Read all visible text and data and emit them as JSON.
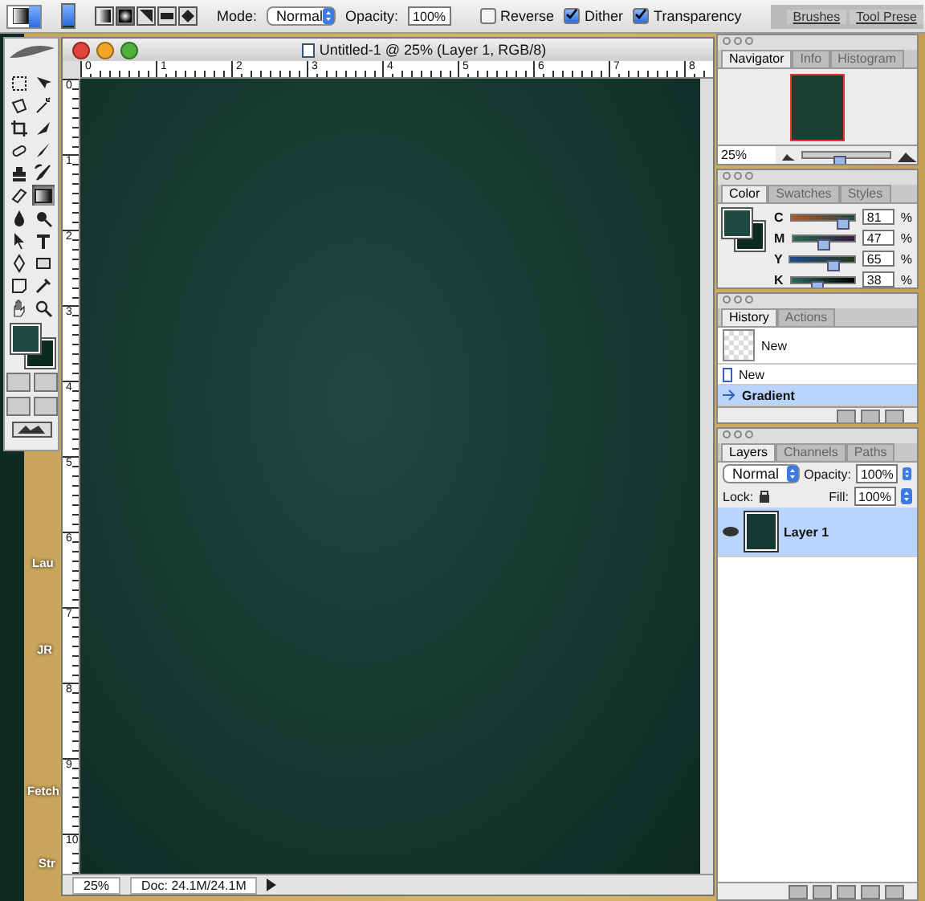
{
  "options_bar": {
    "gradient_types": [
      {
        "kind": "linear",
        "selected": false
      },
      {
        "kind": "radial",
        "selected": true
      },
      {
        "kind": "angle",
        "selected": false
      },
      {
        "kind": "reflected",
        "selected": false
      },
      {
        "kind": "diamond",
        "selected": false
      }
    ],
    "mode_label": "Mode:",
    "mode": "Normal",
    "opacity_label": "Opacity:",
    "opacity": "100%",
    "checkboxes": [
      {
        "label": "Reverse",
        "checked": false
      },
      {
        "label": "Dither",
        "checked": true
      },
      {
        "label": "Transparency",
        "checked": true
      }
    ],
    "well_tabs": [
      "Brushes",
      "Tool Prese"
    ]
  },
  "toolbox": {
    "tools": [
      {
        "kind": "marquee",
        "selected": false
      },
      {
        "kind": "move",
        "selected": false
      },
      {
        "kind": "lasso",
        "selected": false
      },
      {
        "kind": "wand",
        "selected": false
      },
      {
        "kind": "crop",
        "selected": false
      },
      {
        "kind": "slice",
        "selected": false
      },
      {
        "kind": "heal",
        "selected": false
      },
      {
        "kind": "brush",
        "selected": false
      },
      {
        "kind": "stamp",
        "selected": false
      },
      {
        "kind": "history",
        "selected": false
      },
      {
        "kind": "eraser",
        "selected": false
      },
      {
        "kind": "gradient",
        "selected": true
      },
      {
        "kind": "blur",
        "selected": false
      },
      {
        "kind": "dodge",
        "selected": false
      },
      {
        "kind": "select",
        "selected": false
      },
      {
        "kind": "type",
        "selected": false
      },
      {
        "kind": "pen",
        "selected": false
      },
      {
        "kind": "shape",
        "selected": false
      },
      {
        "kind": "notes",
        "selected": false
      },
      {
        "kind": "eyedropper",
        "selected": false
      },
      {
        "kind": "hand",
        "selected": false
      },
      {
        "kind": "zoom",
        "selected": false
      }
    ]
  },
  "desktop_labels": [
    "Lau",
    "JR",
    "Fetch",
    "Str"
  ],
  "document": {
    "title": "Untitled-1 @ 25% (Layer 1, RGB/8)",
    "h_ruler": [
      "0",
      "1",
      "2",
      "3",
      "4",
      "5",
      "6",
      "7",
      "8"
    ],
    "v_ruler": [
      "0",
      "1",
      "2",
      "3",
      "4",
      "5",
      "6",
      "7",
      "8",
      "9",
      "10"
    ],
    "zoom": "25%",
    "doc_size": "Doc: 24.1M/24.1M"
  },
  "navigator": {
    "tabs": [
      {
        "label": "Navigator",
        "selected": true
      },
      {
        "label": "Info",
        "selected": false
      },
      {
        "label": "Histogram",
        "selected": false
      }
    ],
    "zoom": "25%",
    "level": 0.4
  },
  "color": {
    "tabs": [
      {
        "label": "Color",
        "selected": true
      },
      {
        "label": "Swatches",
        "selected": false
      },
      {
        "label": "Styles",
        "selected": false
      }
    ],
    "channels": [
      {
        "name": "C",
        "value": "81",
        "unit": "%",
        "level": 0.81
      },
      {
        "name": "M",
        "value": "47",
        "unit": "%",
        "level": 0.47
      },
      {
        "name": "Y",
        "value": "65",
        "unit": "%",
        "level": 0.65
      },
      {
        "name": "K",
        "value": "38",
        "unit": "%",
        "level": 0.38
      }
    ]
  },
  "history": {
    "tabs": [
      {
        "label": "History",
        "selected": true
      },
      {
        "label": "Actions",
        "selected": false
      }
    ],
    "items": [
      {
        "kind": "snapshot",
        "label": "New",
        "selected": false
      },
      {
        "kind": "step",
        "label": "New",
        "selected": false
      },
      {
        "kind": "step",
        "label": "Gradient",
        "selected": true
      }
    ]
  },
  "layers": {
    "tabs": [
      {
        "label": "Layers",
        "selected": true
      },
      {
        "label": "Channels",
        "selected": false
      },
      {
        "label": "Paths",
        "selected": false
      }
    ],
    "blend": "Normal",
    "opacity_label": "Opacity:",
    "opacity": "100%",
    "lock_label": "Lock:",
    "fill_label": "Fill:",
    "fill": "100%",
    "items": [
      {
        "name": "Layer 1",
        "visible": true,
        "selected": true
      }
    ]
  }
}
